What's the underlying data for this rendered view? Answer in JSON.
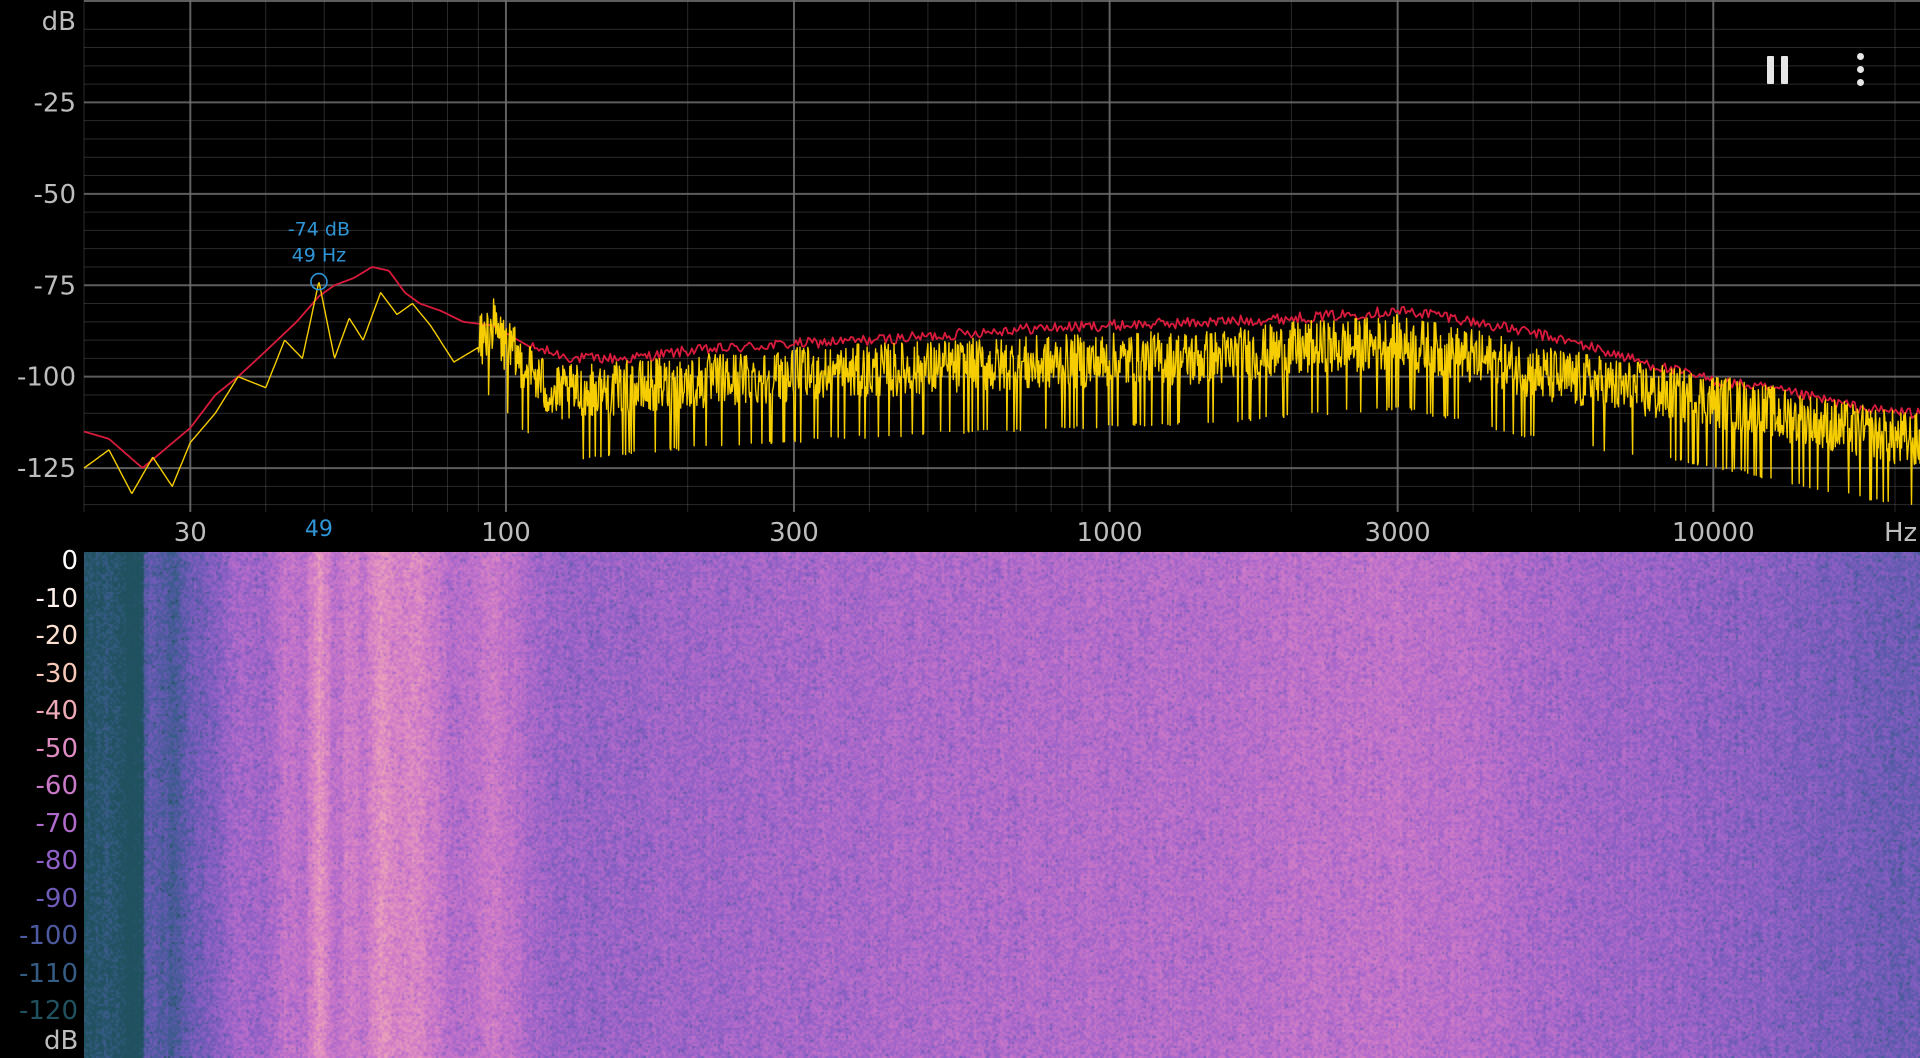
{
  "chart_data": [
    {
      "type": "line",
      "title": "",
      "xlabel": "Hz",
      "ylabel": "dB",
      "x_scale": "log",
      "xlim": [
        20,
        22000
      ],
      "ylim": [
        -137,
        3
      ],
      "x_ticks": [
        {
          "value": 30,
          "label": "30"
        },
        {
          "value": 100,
          "label": "100"
        },
        {
          "value": 300,
          "label": "300"
        },
        {
          "value": 1000,
          "label": "1000"
        },
        {
          "value": 3000,
          "label": "3000"
        },
        {
          "value": 10000,
          "label": "10000"
        }
      ],
      "y_ticks": [
        {
          "value": -25,
          "label": "-25"
        },
        {
          "value": -50,
          "label": "-50"
        },
        {
          "value": -75,
          "label": "-75"
        },
        {
          "value": -100,
          "label": "-100"
        },
        {
          "value": -125,
          "label": "-125"
        }
      ],
      "grid": true,
      "series": [
        {
          "color": "#d81b3c",
          "points": [
            [
              20,
              -115
            ],
            [
              22,
              -117
            ],
            [
              25,
              -125
            ],
            [
              30,
              -114
            ],
            [
              33,
              -105
            ],
            [
              36,
              -100
            ],
            [
              40,
              -93
            ],
            [
              45,
              -85
            ],
            [
              49,
              -78
            ],
            [
              52,
              -75
            ],
            [
              56,
              -73
            ],
            [
              60,
              -70
            ],
            [
              64,
              -71
            ],
            [
              68,
              -77
            ],
            [
              72,
              -80
            ],
            [
              78,
              -82
            ],
            [
              85,
              -85
            ],
            [
              95,
              -86
            ],
            [
              110,
              -92
            ],
            [
              130,
              -95
            ],
            [
              160,
              -95
            ],
            [
              200,
              -93
            ],
            [
              300,
              -91
            ],
            [
              400,
              -90
            ],
            [
              500,
              -89
            ],
            [
              700,
              -87
            ],
            [
              1000,
              -86
            ],
            [
              1500,
              -85
            ],
            [
              2000,
              -84
            ],
            [
              2500,
              -83
            ],
            [
              3000,
              -82
            ],
            [
              3500,
              -83
            ],
            [
              4000,
              -85
            ],
            [
              5000,
              -88
            ],
            [
              6000,
              -91
            ],
            [
              8000,
              -97
            ],
            [
              10000,
              -101
            ],
            [
              12000,
              -103
            ],
            [
              15000,
              -106
            ],
            [
              18000,
              -109
            ],
            [
              22000,
              -110
            ]
          ]
        },
        {
          "color": "#f5cd00",
          "noise": true,
          "points": [
            [
              20,
              -125
            ],
            [
              22,
              -120
            ],
            [
              24,
              -132
            ],
            [
              26,
              -122
            ],
            [
              28,
              -130
            ],
            [
              30,
              -118
            ],
            [
              33,
              -110
            ],
            [
              36,
              -100
            ],
            [
              40,
              -103
            ],
            [
              43,
              -90
            ],
            [
              46,
              -95
            ],
            [
              49,
              -74
            ],
            [
              52,
              -95
            ],
            [
              55,
              -84
            ],
            [
              58,
              -90
            ],
            [
              62,
              -77
            ],
            [
              66,
              -83
            ],
            [
              70,
              -80
            ],
            [
              75,
              -86
            ],
            [
              82,
              -96
            ],
            [
              90,
              -92
            ],
            [
              95,
              -86
            ],
            [
              100,
              -92
            ],
            [
              120,
              -105
            ],
            [
              150,
              -104
            ],
            [
              200,
              -102
            ],
            [
              300,
              -100
            ],
            [
              500,
              -98
            ],
            [
              700,
              -97
            ],
            [
              1000,
              -96
            ],
            [
              1500,
              -95
            ],
            [
              2000,
              -93
            ],
            [
              3000,
              -91
            ],
            [
              4000,
              -95
            ],
            [
              5000,
              -99
            ],
            [
              7000,
              -103
            ],
            [
              10000,
              -107
            ],
            [
              14000,
              -112
            ],
            [
              18000,
              -116
            ],
            [
              22000,
              -118
            ]
          ]
        }
      ],
      "peak": {
        "frequency": 49,
        "level": -74,
        "freq_label": "49 Hz",
        "level_label": "-74 dB",
        "axis_label": "49"
      }
    },
    {
      "type": "heatmap",
      "title": "",
      "xlabel": "",
      "ylabel": "",
      "color_scale_unit": "dB",
      "color_scale": [
        {
          "value": 0,
          "label": "0",
          "color": "#ffffff"
        },
        {
          "value": -10,
          "label": "-10",
          "color": "#fff1ec"
        },
        {
          "value": -20,
          "label": "-20",
          "color": "#fde0d0"
        },
        {
          "value": -30,
          "label": "-30",
          "color": "#f7c8b8"
        },
        {
          "value": -40,
          "label": "-40",
          "color": "#eeaab7"
        },
        {
          "value": -50,
          "label": "-50",
          "color": "#e08cc3"
        },
        {
          "value": -60,
          "label": "-60",
          "color": "#cb78c9"
        },
        {
          "value": -70,
          "label": "-70",
          "color": "#b06acb"
        },
        {
          "value": -80,
          "label": "-80",
          "color": "#8f60c6"
        },
        {
          "value": -90,
          "label": "-90",
          "color": "#6f5bb8"
        },
        {
          "value": -100,
          "label": "-100",
          "color": "#4e5aa0"
        },
        {
          "value": -110,
          "label": "-110",
          "color": "#355c83"
        },
        {
          "value": -120,
          "label": "-120",
          "color": "#20515f"
        }
      ]
    }
  ],
  "controls": {
    "pause": "pause-icon",
    "menu": "more-vert-icon"
  },
  "colors": {
    "grid": "#6e6e6e",
    "tick_label": "#bdbdbd",
    "peak": "#2f95d6"
  }
}
